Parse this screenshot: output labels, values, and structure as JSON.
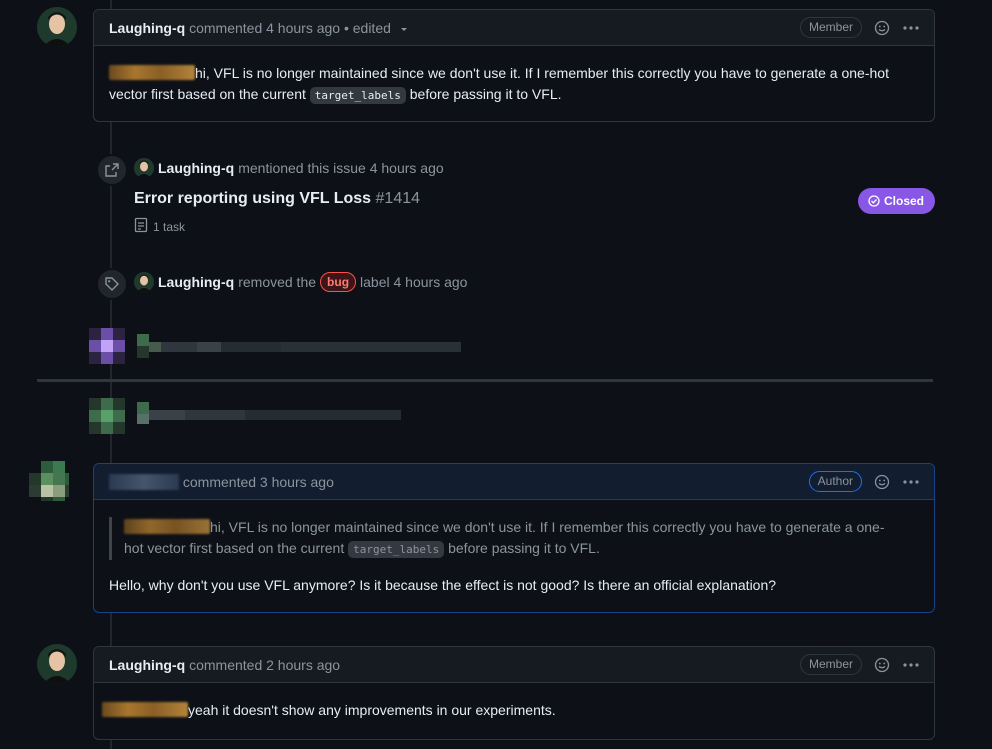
{
  "comment1": {
    "author": "Laughing-q",
    "meta": "commented 4 hours ago • edited",
    "role": "Member",
    "body_part1": "hi, VFL is no longer maintained since we don't use it. If I remember this correctly you have to generate a one-hot",
    "body_part2": "vector first based on the current",
    "code": "target_labels",
    "body_part3": "before passing it to VFL."
  },
  "event_mention": {
    "author": "Laughing-q",
    "text": "mentioned this issue 4 hours ago",
    "issue_title": "Error reporting using VFL Loss",
    "issue_number": "#1414",
    "tasks": "1 task",
    "status": "Closed"
  },
  "event_label": {
    "author": "Laughing-q",
    "text_before": "removed the",
    "label": "bug",
    "text_after": "label 4 hours ago"
  },
  "comment2": {
    "meta": "commented 3 hours ago",
    "role": "Author",
    "quote_part1": "hi, VFL is no longer maintained since we don't use it. If I remember this correctly you have to generate a one-",
    "quote_part2": "hot vector first based on the current",
    "code": "target_labels",
    "quote_part3": "before passing it to VFL.",
    "body": "Hello, why don't you use VFL anymore? Is it because the effect is not good? Is there an official explanation?"
  },
  "comment3": {
    "author": "Laughing-q",
    "meta": "commented 2 hours ago",
    "role": "Member",
    "body": "yeah it doesn't show any improvements in our experiments."
  },
  "icons": {
    "emoji": "smiley-icon",
    "more": "kebab-horizontal-icon",
    "dropdown": "triangle-down-icon",
    "cross_reference": "cross-reference-icon",
    "tag": "tag-icon",
    "task": "checklist-icon",
    "closed": "issue-closed-icon"
  },
  "colors": {
    "background": "#0d1117",
    "closed_badge": "#8957e5",
    "bug_label": "#f85149",
    "author_border": "#1f6feb"
  }
}
